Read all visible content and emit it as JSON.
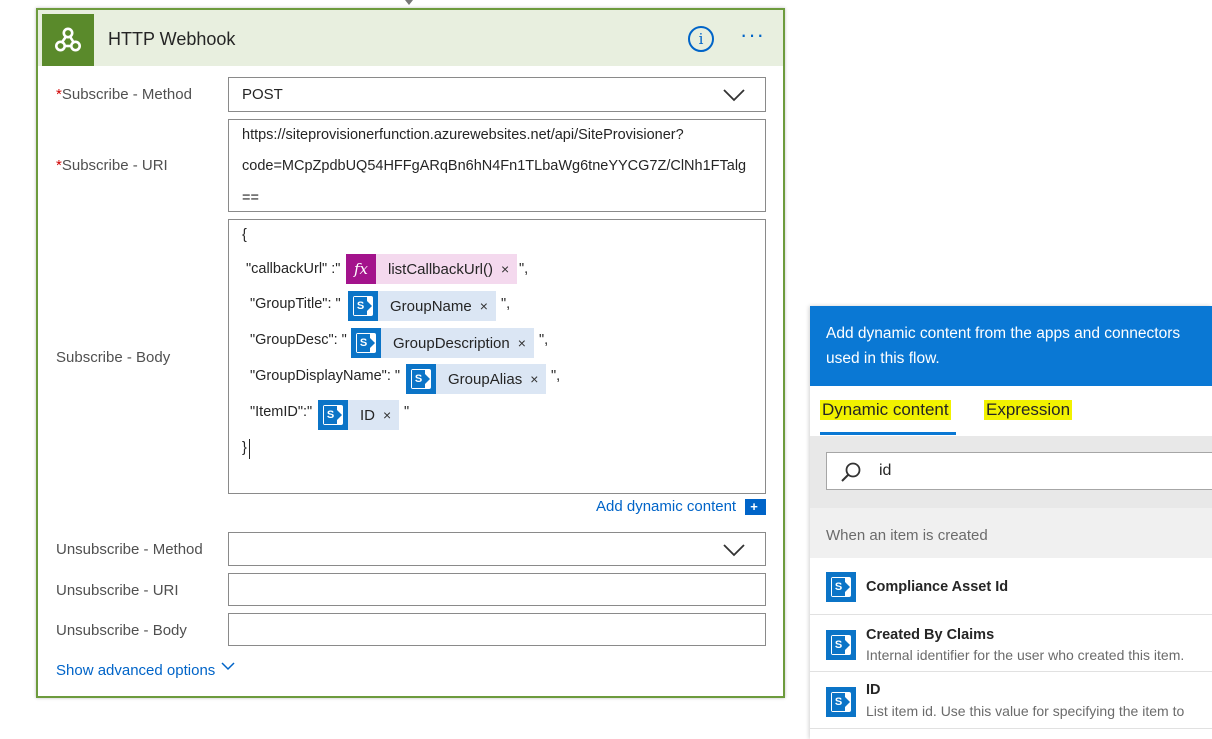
{
  "card": {
    "title": "HTTP Webhook",
    "info_glyph": "i",
    "more_glyph": "···",
    "required_marker": "*"
  },
  "fields": {
    "subscribe_method_label": "Subscribe - Method",
    "subscribe_method_value": "POST",
    "subscribe_uri_label": "Subscribe - URI",
    "subscribe_uri_lines": [
      "https://siteprovisionerfunction.azurewebsites.net/api/SiteProvisioner?",
      "code=MCpZpdbUQ54HFFgARqBn6hN4Fn1TLbaWg6tneYYCG7Z/ClNh1FTalg",
      "=="
    ],
    "subscribe_body_label": "Subscribe - Body",
    "body": {
      "open_brace": "{",
      "close_brace": "}",
      "callback_key": "\"callbackUrl\" :\"",
      "callback_token": "listCallbackUrl()",
      "callback_suffix": "\",",
      "grouptitle_key": "\"GroupTitle\": \"",
      "grouptitle_token": "GroupName",
      "grouptitle_suffix": "\",",
      "groupdesc_key": "\"GroupDesc\": \"",
      "groupdesc_token": "GroupDescription",
      "groupdesc_suffix": "\",",
      "groupdisplay_key": "\"GroupDisplayName\": \"",
      "groupdisplay_token": "GroupAlias",
      "groupdisplay_suffix": "\",",
      "itemid_key": "\"ItemID\":\"",
      "itemid_token": "ID",
      "itemid_suffix": "\"",
      "remove_glyph": "×",
      "fx_glyph": "fx"
    },
    "add_dynamic_content": "Add dynamic content",
    "add_dynamic_icon": "+",
    "unsubscribe_method_label": "Unsubscribe - Method",
    "unsubscribe_method_value": "",
    "unsubscribe_uri_label": "Unsubscribe - URI",
    "unsubscribe_uri_value": "",
    "unsubscribe_body_label": "Unsubscribe - Body",
    "unsubscribe_body_value": "",
    "show_advanced": "Show advanced options"
  },
  "panel": {
    "header_line1": "Add dynamic content from the apps and connectors",
    "header_line2": "used in this flow.",
    "tab_dynamic": "Dynamic content",
    "tab_expression": "Expression",
    "search_value": "id",
    "section_label": "When an item is created",
    "items": [
      {
        "title": "Compliance Asset Id",
        "desc": ""
      },
      {
        "title": "Created By Claims",
        "desc": "Internal identifier for the user who created this item."
      },
      {
        "title": "ID",
        "desc": "List item id. Use this value for specifying the item to"
      }
    ]
  },
  "colors": {
    "card_border": "#6d9b3d",
    "header_bg": "#e8efdf",
    "webhook_icon_bg": "#5a8a2b",
    "link_blue": "#0064c8",
    "panel_blue": "#0a78d4",
    "fx_token": "#a3138c",
    "sharepoint_token": "#0b74c7",
    "highlight_yellow": "#f2f200"
  },
  "icons": {
    "card": "webhook-icon",
    "fx": "expression-icon",
    "sp": "sharepoint-icon",
    "search": "search-icon"
  }
}
